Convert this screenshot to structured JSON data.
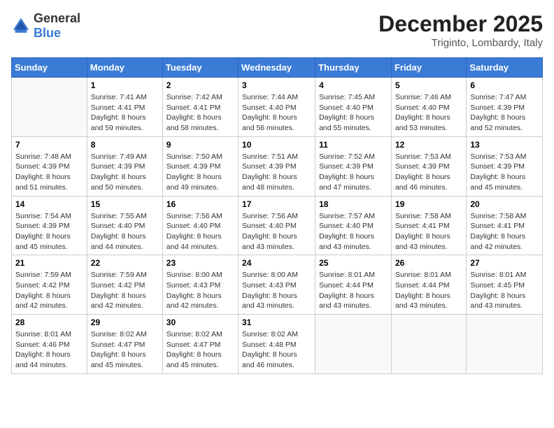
{
  "logo": {
    "general": "General",
    "blue": "Blue"
  },
  "header": {
    "month": "December 2025",
    "location": "Triginto, Lombardy, Italy"
  },
  "days_of_week": [
    "Sunday",
    "Monday",
    "Tuesday",
    "Wednesday",
    "Thursday",
    "Friday",
    "Saturday"
  ],
  "weeks": [
    [
      {
        "day": "",
        "info": ""
      },
      {
        "day": "1",
        "info": "Sunrise: 7:41 AM\nSunset: 4:41 PM\nDaylight: 8 hours\nand 59 minutes."
      },
      {
        "day": "2",
        "info": "Sunrise: 7:42 AM\nSunset: 4:41 PM\nDaylight: 8 hours\nand 58 minutes."
      },
      {
        "day": "3",
        "info": "Sunrise: 7:44 AM\nSunset: 4:40 PM\nDaylight: 8 hours\nand 56 minutes."
      },
      {
        "day": "4",
        "info": "Sunrise: 7:45 AM\nSunset: 4:40 PM\nDaylight: 8 hours\nand 55 minutes."
      },
      {
        "day": "5",
        "info": "Sunrise: 7:46 AM\nSunset: 4:40 PM\nDaylight: 8 hours\nand 53 minutes."
      },
      {
        "day": "6",
        "info": "Sunrise: 7:47 AM\nSunset: 4:39 PM\nDaylight: 8 hours\nand 52 minutes."
      }
    ],
    [
      {
        "day": "7",
        "info": "Sunrise: 7:48 AM\nSunset: 4:39 PM\nDaylight: 8 hours\nand 51 minutes."
      },
      {
        "day": "8",
        "info": "Sunrise: 7:49 AM\nSunset: 4:39 PM\nDaylight: 8 hours\nand 50 minutes."
      },
      {
        "day": "9",
        "info": "Sunrise: 7:50 AM\nSunset: 4:39 PM\nDaylight: 8 hours\nand 49 minutes."
      },
      {
        "day": "10",
        "info": "Sunrise: 7:51 AM\nSunset: 4:39 PM\nDaylight: 8 hours\nand 48 minutes."
      },
      {
        "day": "11",
        "info": "Sunrise: 7:52 AM\nSunset: 4:39 PM\nDaylight: 8 hours\nand 47 minutes."
      },
      {
        "day": "12",
        "info": "Sunrise: 7:53 AM\nSunset: 4:39 PM\nDaylight: 8 hours\nand 46 minutes."
      },
      {
        "day": "13",
        "info": "Sunrise: 7:53 AM\nSunset: 4:39 PM\nDaylight: 8 hours\nand 45 minutes."
      }
    ],
    [
      {
        "day": "14",
        "info": "Sunrise: 7:54 AM\nSunset: 4:39 PM\nDaylight: 8 hours\nand 45 minutes."
      },
      {
        "day": "15",
        "info": "Sunrise: 7:55 AM\nSunset: 4:40 PM\nDaylight: 8 hours\nand 44 minutes."
      },
      {
        "day": "16",
        "info": "Sunrise: 7:56 AM\nSunset: 4:40 PM\nDaylight: 8 hours\nand 44 minutes."
      },
      {
        "day": "17",
        "info": "Sunrise: 7:56 AM\nSunset: 4:40 PM\nDaylight: 8 hours\nand 43 minutes."
      },
      {
        "day": "18",
        "info": "Sunrise: 7:57 AM\nSunset: 4:40 PM\nDaylight: 8 hours\nand 43 minutes."
      },
      {
        "day": "19",
        "info": "Sunrise: 7:58 AM\nSunset: 4:41 PM\nDaylight: 8 hours\nand 43 minutes."
      },
      {
        "day": "20",
        "info": "Sunrise: 7:58 AM\nSunset: 4:41 PM\nDaylight: 8 hours\nand 42 minutes."
      }
    ],
    [
      {
        "day": "21",
        "info": "Sunrise: 7:59 AM\nSunset: 4:42 PM\nDaylight: 8 hours\nand 42 minutes."
      },
      {
        "day": "22",
        "info": "Sunrise: 7:59 AM\nSunset: 4:42 PM\nDaylight: 8 hours\nand 42 minutes."
      },
      {
        "day": "23",
        "info": "Sunrise: 8:00 AM\nSunset: 4:43 PM\nDaylight: 8 hours\nand 42 minutes."
      },
      {
        "day": "24",
        "info": "Sunrise: 8:00 AM\nSunset: 4:43 PM\nDaylight: 8 hours\nand 43 minutes."
      },
      {
        "day": "25",
        "info": "Sunrise: 8:01 AM\nSunset: 4:44 PM\nDaylight: 8 hours\nand 43 minutes."
      },
      {
        "day": "26",
        "info": "Sunrise: 8:01 AM\nSunset: 4:44 PM\nDaylight: 8 hours\nand 43 minutes."
      },
      {
        "day": "27",
        "info": "Sunrise: 8:01 AM\nSunset: 4:45 PM\nDaylight: 8 hours\nand 43 minutes."
      }
    ],
    [
      {
        "day": "28",
        "info": "Sunrise: 8:01 AM\nSunset: 4:46 PM\nDaylight: 8 hours\nand 44 minutes."
      },
      {
        "day": "29",
        "info": "Sunrise: 8:02 AM\nSunset: 4:47 PM\nDaylight: 8 hours\nand 45 minutes."
      },
      {
        "day": "30",
        "info": "Sunrise: 8:02 AM\nSunset: 4:47 PM\nDaylight: 8 hours\nand 45 minutes."
      },
      {
        "day": "31",
        "info": "Sunrise: 8:02 AM\nSunset: 4:48 PM\nDaylight: 8 hours\nand 46 minutes."
      },
      {
        "day": "",
        "info": ""
      },
      {
        "day": "",
        "info": ""
      },
      {
        "day": "",
        "info": ""
      }
    ]
  ]
}
